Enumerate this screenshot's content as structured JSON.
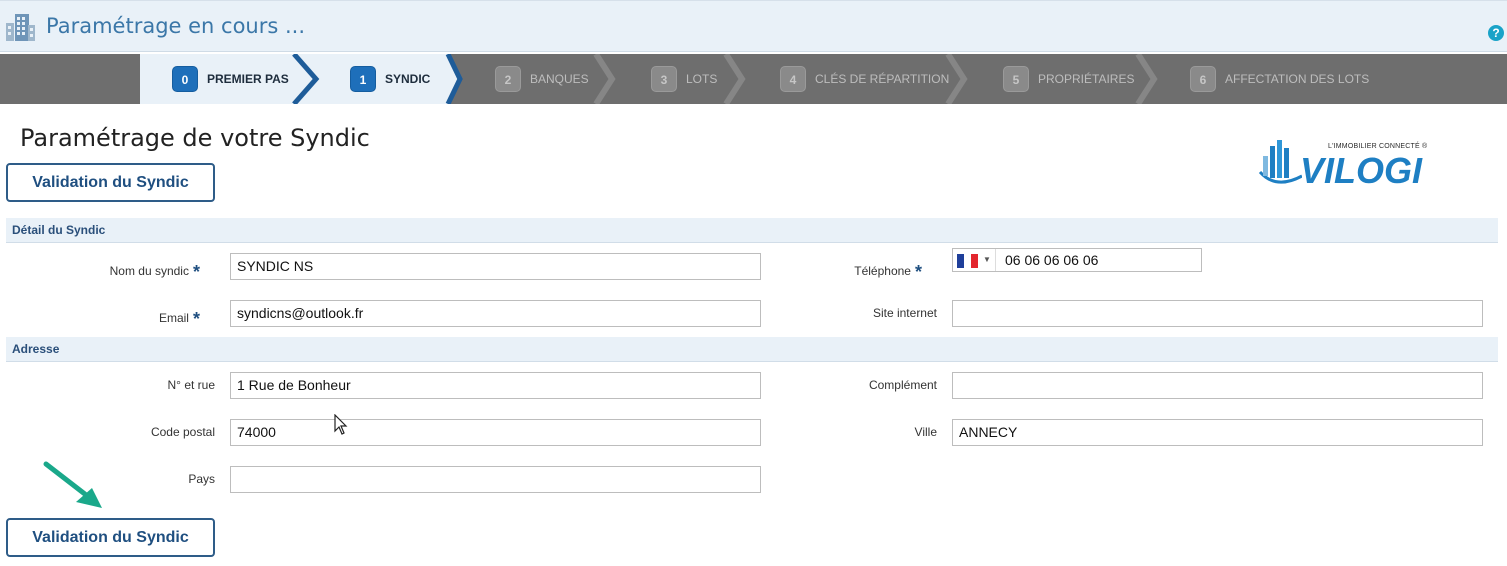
{
  "header": {
    "title": "Paramétrage en cours ...",
    "help": "?"
  },
  "wizard": {
    "steps": [
      {
        "num": "0",
        "label": "PREMIER PAS",
        "state": "active"
      },
      {
        "num": "1",
        "label": "SYNDIC",
        "state": "active"
      },
      {
        "num": "2",
        "label": "BANQUES",
        "state": "inactive"
      },
      {
        "num": "3",
        "label": "LOTS",
        "state": "inactive"
      },
      {
        "num": "4",
        "label": "CLÉS DE RÉPARTITION",
        "state": "inactive"
      },
      {
        "num": "5",
        "label": "PROPRIÉTAIRES",
        "state": "inactive"
      },
      {
        "num": "6",
        "label": "AFFECTATION DES LOTS",
        "state": "inactive"
      }
    ]
  },
  "page": {
    "title": "Paramétrage de votre Syndic",
    "validate_label": "Validation du Syndic"
  },
  "logo": {
    "tagline": "L'IMMOBILIER CONNECTÉ ®",
    "name": "VILOGI"
  },
  "sections": {
    "detail": "Détail du Syndic",
    "address": "Adresse"
  },
  "form": {
    "nom_label": "Nom du syndic",
    "nom_value": "SYNDIC NS",
    "telephone_label": "Téléphone",
    "telephone_value": "06 06 06 06 06",
    "email_label": "Email",
    "email_value": "syndicns@outlook.fr",
    "site_label": "Site internet",
    "site_value": "",
    "rue_label": "N° et rue",
    "rue_value": "1 Rue de Bonheur",
    "complement_label": "Complément",
    "complement_value": "",
    "cp_label": "Code postal",
    "cp_value": "74000",
    "ville_label": "Ville",
    "ville_value": "ANNECY",
    "pays_label": "Pays",
    "pays_value": "",
    "required_mark": "*"
  },
  "colors": {
    "accent": "#1e6fba",
    "wizard_bg": "#6e6e6e",
    "arrow": "#1aa88a"
  }
}
